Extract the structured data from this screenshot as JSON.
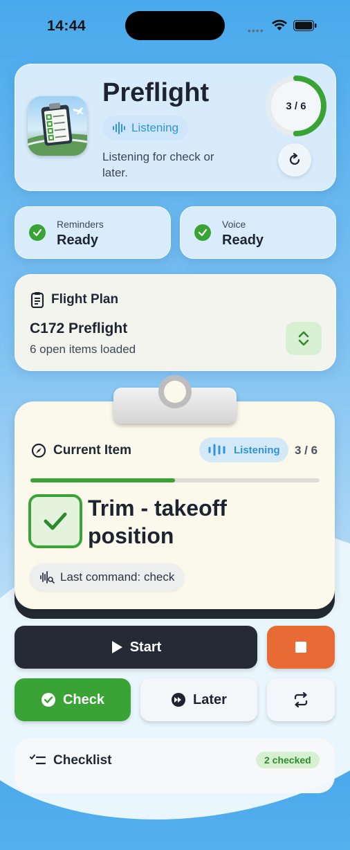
{
  "status_bar": {
    "time": "14:44"
  },
  "header": {
    "title": "Preflight",
    "listening_label": "Listening",
    "subtitle": "Listening for check or later.",
    "progress_label": "3 / 6",
    "progress_fraction": 0.5
  },
  "reminders": {
    "label": "Reminders",
    "value": "Ready"
  },
  "voice": {
    "label": "Voice",
    "value": "Ready"
  },
  "flight_plan": {
    "heading": "Flight Plan",
    "name": "C172 Preflight",
    "summary": "6 open items loaded"
  },
  "current_item": {
    "heading": "Current Item",
    "listening_label": "Listening",
    "count": "3 / 6",
    "progress_fraction": 0.5,
    "title": "Trim - takeoff position",
    "last_command": "Last command: check"
  },
  "controls": {
    "start_label": "Start",
    "check_label": "Check",
    "later_label": "Later"
  },
  "checklist": {
    "heading": "Checklist",
    "badge": "2 checked"
  },
  "colors": {
    "accent_green": "#3aa336",
    "accent_blue": "#2f93da",
    "stop_orange": "#e86b36",
    "dark": "#242b36"
  }
}
